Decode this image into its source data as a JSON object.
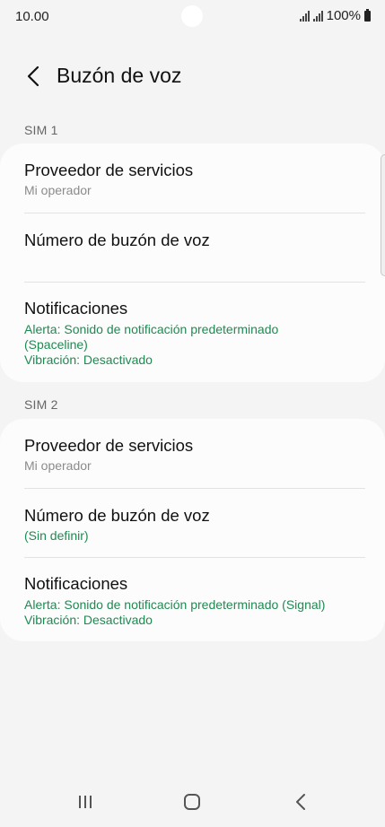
{
  "status_bar": {
    "time": "10.00",
    "battery": "100%",
    "icons": [
      "signal-sim1-icon",
      "signal-sim2-icon",
      "battery-icon"
    ]
  },
  "header": {
    "title": "Buzón de voz",
    "back_icon": "chevron-left-icon"
  },
  "sim1": {
    "label": "SIM 1",
    "provider": {
      "title": "Proveedor de servicios",
      "value": "Mi operador"
    },
    "voicemail_number": {
      "title": "Número de buzón de voz",
      "value": ""
    },
    "notifications": {
      "title": "Notificaciones",
      "alert_line1": "Alerta: Sonido de notificación predeterminado",
      "alert_line2": "(Spaceline)",
      "vibration": "Vibración: Desactivado"
    }
  },
  "sim2": {
    "label": "SIM 2",
    "provider": {
      "title": "Proveedor de servicios",
      "value": "Mi operador"
    },
    "voicemail_number": {
      "title": "Número de buzón de voz",
      "value": "(Sin definir)"
    },
    "notifications": {
      "title": "Notificaciones",
      "alert": "Alerta: Sonido de notificación predeterminado (Signal)",
      "vibration": "Vibración: Desactivado"
    }
  },
  "nav_bar": {
    "icons": [
      "recent-apps-icon",
      "home-icon",
      "back-icon"
    ]
  },
  "colors": {
    "accent_green": "#1f8a52",
    "background": "#f4f4f4",
    "card": "#fcfcfc"
  }
}
